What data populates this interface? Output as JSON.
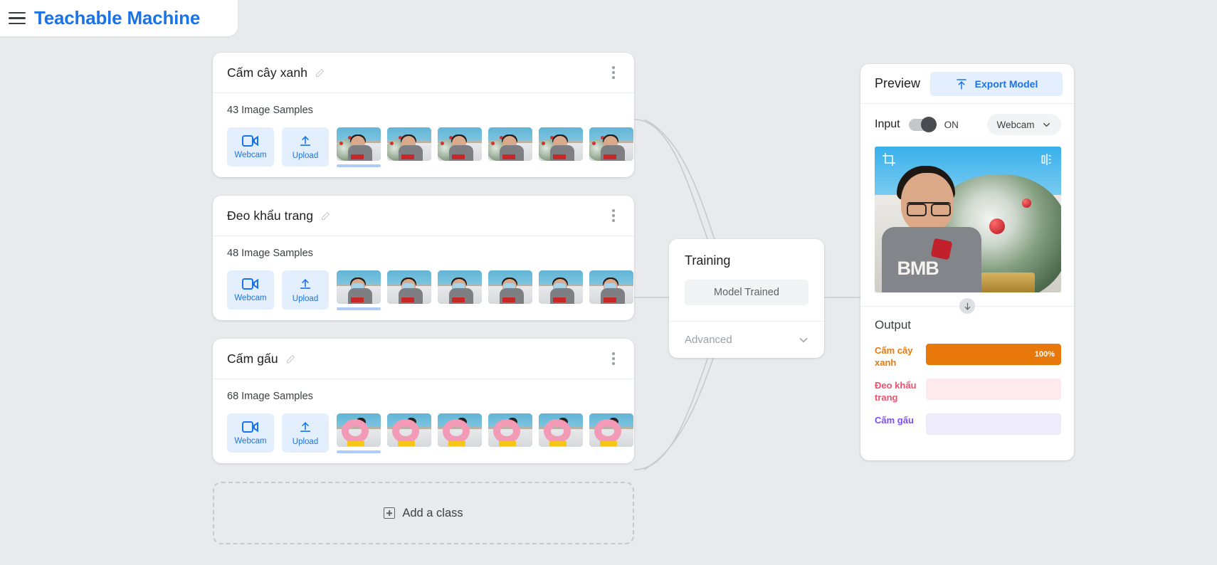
{
  "app": {
    "title": "Teachable Machine",
    "menu_icon": "hamburger-menu-icon",
    "brand_color": "#1a73e8"
  },
  "classes": [
    {
      "name": "Cấm cây xanh",
      "samples_label": "43 Image Samples",
      "webcam_label": "Webcam",
      "upload_label": "Upload",
      "thumb_kind": "plant",
      "thumb_count": 7
    },
    {
      "name": "Đeo khẩu trang",
      "samples_label": "48 Image Samples",
      "webcam_label": "Webcam",
      "upload_label": "Upload",
      "thumb_kind": "mask",
      "thumb_count": 7
    },
    {
      "name": "Cấm gấu",
      "samples_label": "68 Image Samples",
      "webcam_label": "Webcam",
      "upload_label": "Upload",
      "thumb_kind": "donut",
      "thumb_count": 7
    }
  ],
  "add_class": {
    "label": "Add a class",
    "icon": "plus-square-icon"
  },
  "training": {
    "title": "Training",
    "button_label": "Model Trained",
    "advanced_label": "Advanced",
    "chevron_icon": "chevron-down-icon"
  },
  "preview": {
    "title": "Preview",
    "export_label": "Export Model",
    "export_icon": "upload-export-icon",
    "input_label": "Input",
    "toggle_state": "ON",
    "source_value": "Webcam",
    "source_chevron_icon": "chevron-down-icon",
    "crop_icon": "crop-icon",
    "flip_icon": "flip-horizontal-icon",
    "flow_arrow_icon": "arrow-down-icon",
    "output_title": "Output"
  },
  "output_rows": [
    {
      "label": "Cấm cây xanh",
      "percent": 100,
      "percent_text": "100%",
      "color": "#e8780c",
      "track": "#f6ede2",
      "show_text": true
    },
    {
      "label": "Đeo khẩu trang",
      "percent": 0,
      "percent_text": "",
      "color": "#f2506e",
      "track": "#fdeaee",
      "show_text": false
    },
    {
      "label": "Cấm gấu",
      "percent": 0,
      "percent_text": "",
      "color": "#7a4ff2",
      "track": "#eeecfb",
      "show_text": false
    }
  ]
}
